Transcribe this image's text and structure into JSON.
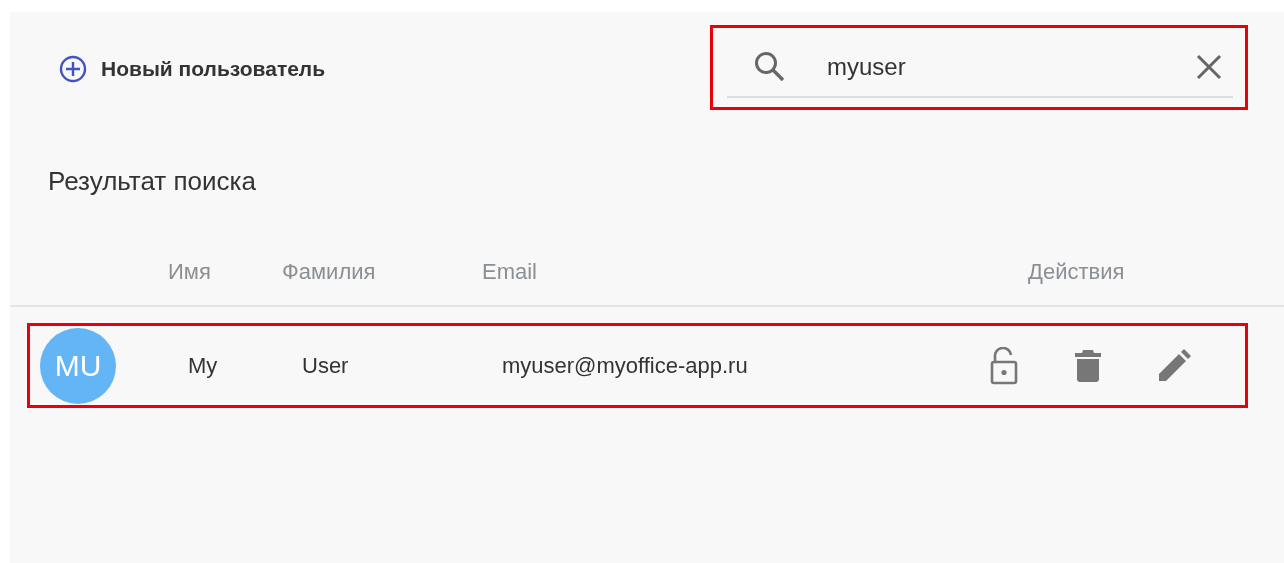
{
  "new_user_button": {
    "label": "Новый пользователь"
  },
  "search": {
    "value": "myuser",
    "highlighted": true
  },
  "section_title": "Результат поиска",
  "table": {
    "columns": [
      "Имя",
      "Фамилия",
      "Email",
      "Действия"
    ],
    "rows": [
      {
        "avatar": "MU",
        "color": "#64b5f6",
        "first_name": "My",
        "last_name": "User",
        "email": "myuser@myoffice-app.ru",
        "highlighted": true
      }
    ]
  }
}
